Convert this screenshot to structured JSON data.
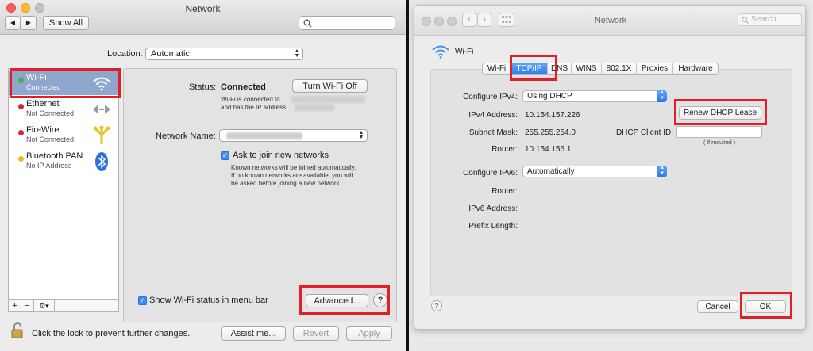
{
  "left": {
    "title": "Network",
    "toolbar": {
      "back": "◀",
      "forward": "▶",
      "show_all": "Show All",
      "search_placeholder": ""
    },
    "location_label": "Location:",
    "location_value": "Automatic",
    "sidebar": [
      {
        "name": "Wi-Fi",
        "status": "Connected",
        "dot": "#3fb63f",
        "icon": "wifi-icon"
      },
      {
        "name": "Ethernet",
        "status": "Not Connected",
        "dot": "#d9262b",
        "icon": "ethernet-arrows-icon"
      },
      {
        "name": "FireWire",
        "status": "Not Connected",
        "dot": "#d9262b",
        "icon": "firewire-icon"
      },
      {
        "name": "Bluetooth PAN",
        "status": "No IP Address",
        "dot": "#f0b528",
        "icon": "bluetooth-icon"
      }
    ],
    "sidebar_footer": {
      "add": "+",
      "remove": "−",
      "action": "⚙▾"
    },
    "status_label": "Status:",
    "status_value": "Connected",
    "turn_off_label": "Turn Wi-Fi Off",
    "status_desc_1": "Wi-Fi is connected to",
    "status_desc_2": "and has the IP address",
    "network_name_label": "Network Name:",
    "ask_label": "Ask to join new networks",
    "ask_desc_1": "Known networks will be joined automatically.",
    "ask_desc_2": "If no known networks are available, you will",
    "ask_desc_3": "be asked before joining a new network.",
    "show_status_label": "Show Wi-Fi status in menu bar",
    "advanced_label": "Advanced...",
    "help_label": "?",
    "lock_text": "Click the lock to prevent further changes.",
    "assist_label": "Assist me...",
    "revert_label": "Revert",
    "apply_label": "Apply"
  },
  "right": {
    "title": "Network",
    "search_placeholder": "Search",
    "service_name": "Wi-Fi",
    "tabs": [
      "Wi-Fi",
      "TCP/IP",
      "DNS",
      "WINS",
      "802.1X",
      "Proxies",
      "Hardware"
    ],
    "active_tab": "TCP/IP",
    "configure_ipv4_label": "Configure IPv4:",
    "configure_ipv4_value": "Using DHCP",
    "ipv4_address_label": "IPv4 Address:",
    "ipv4_address_value": "10.154.157.226",
    "renew_label": "Renew DHCP Lease",
    "subnet_label": "Subnet Mask:",
    "subnet_value": "255.255.254.0",
    "dhcp_client_label": "DHCP Client ID:",
    "dhcp_client_value": "",
    "if_required": "( If required )",
    "router_label": "Router:",
    "router_value": "10.154.156.1",
    "configure_ipv6_label": "Configure IPv6:",
    "configure_ipv6_value": "Automatically",
    "router6_label": "Router:",
    "ipv6_address_label": "IPv6 Address:",
    "prefix_label": "Prefix Length:",
    "help_label": "?",
    "cancel_label": "Cancel",
    "ok_label": "OK"
  },
  "colors": {
    "highlight": "#e01f26",
    "selection": "#8fa7cc",
    "accent": "#2f7bea"
  }
}
